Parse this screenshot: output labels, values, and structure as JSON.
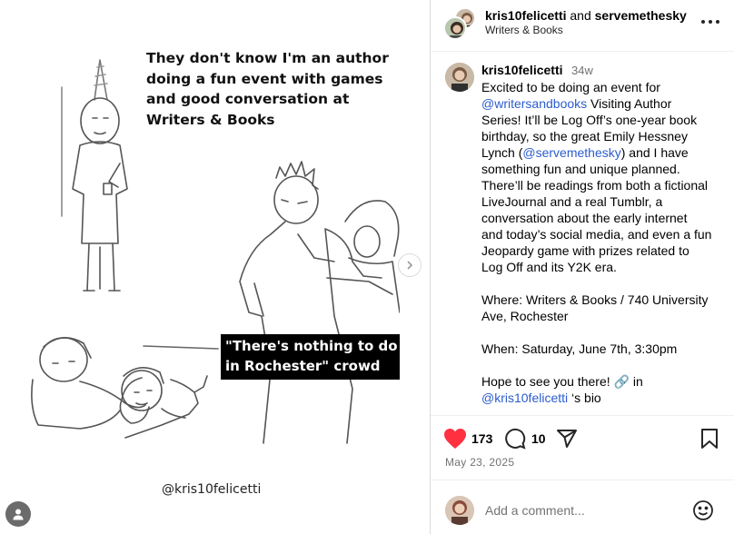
{
  "media": {
    "meme_caption": "They don't know I'm an author doing a fun event with games and good conversation at Writers & Books",
    "crowd_label_line1": "\"There's nothing to do",
    "crowd_label_line2": "in Rochester\" crowd",
    "watermark": "@kris10felicetti",
    "next_icon": "chevron-right-icon",
    "profile_icon": "person-icon"
  },
  "header": {
    "user1": "kris10felicetti",
    "joiner": "and",
    "user2": "servemethesky",
    "subtitle": "Writers & Books",
    "more_icon": "more-horizontal-icon"
  },
  "caption": {
    "username": "kris10felicetti",
    "time": "34w",
    "lines": [
      [
        "Excited to be doing an event for"
      ],
      [
        "@writersandbooks",
        " Visiting Author"
      ],
      [
        "Series! It’ll be Log Off’s one-year book"
      ],
      [
        "birthday, so the great Emily Hessney"
      ],
      [
        "Lynch (",
        "@servemethesky",
        ") and I have"
      ],
      [
        "something fun and unique planned."
      ],
      [
        "There’ll be readings from both a fictional"
      ],
      [
        "LiveJournal and a real Tumblr, a"
      ],
      [
        "conversation about the early internet"
      ],
      [
        "and today’s social media, and even a fun"
      ],
      [
        "Jeopardy game with prizes related to"
      ],
      [
        "Log Off and its Y2K era."
      ],
      [
        ""
      ],
      [
        "Where: Writers & Books / 740 University"
      ],
      [
        "Ave, Rochester"
      ],
      [
        ""
      ],
      [
        "When: Saturday, June 7th, 3:30pm"
      ],
      [
        ""
      ],
      [
        "Hope to see you there! 🔗 in"
      ],
      [
        "@kris10felicetti",
        " ‘s bio"
      ]
    ]
  },
  "actions": {
    "likes": "173",
    "comments": "10",
    "like_color": "#ff3040",
    "date": "May 23, 2025"
  },
  "comment_box": {
    "placeholder": "Add a comment...",
    "emoji_icon": "smiley-icon"
  }
}
